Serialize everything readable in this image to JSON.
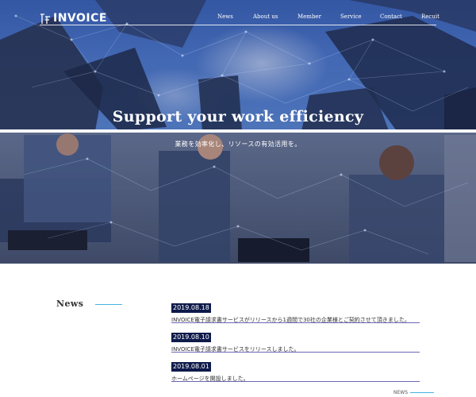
{
  "header": {
    "logo_text": "INVOICE",
    "nav": [
      {
        "label": "News"
      },
      {
        "label": "About us"
      },
      {
        "label": "Member"
      },
      {
        "label": "Service"
      },
      {
        "label": "Contact"
      },
      {
        "label": "Recuit"
      }
    ]
  },
  "hero": {
    "title": "Support your work efficiency",
    "subtitle": "業務を効率化し、リソースの有効活用を。"
  },
  "news": {
    "heading": "News",
    "items": [
      {
        "date": "2019.08.18",
        "text": "INVOICE電子請求書サービスがリリースから1週間で30社の企業様とご契約させて頂きました。"
      },
      {
        "date": "2019.08.10",
        "text": "INVOICE電子請求書サービスをリリースしました。"
      },
      {
        "date": "2019.08.01",
        "text": "ホームページを開設しました。"
      }
    ],
    "more_label": "NEWS"
  },
  "colors": {
    "accent_line": "#46b4e0",
    "date_badge": "#0e1a4a",
    "divider": "#6a66b4"
  }
}
